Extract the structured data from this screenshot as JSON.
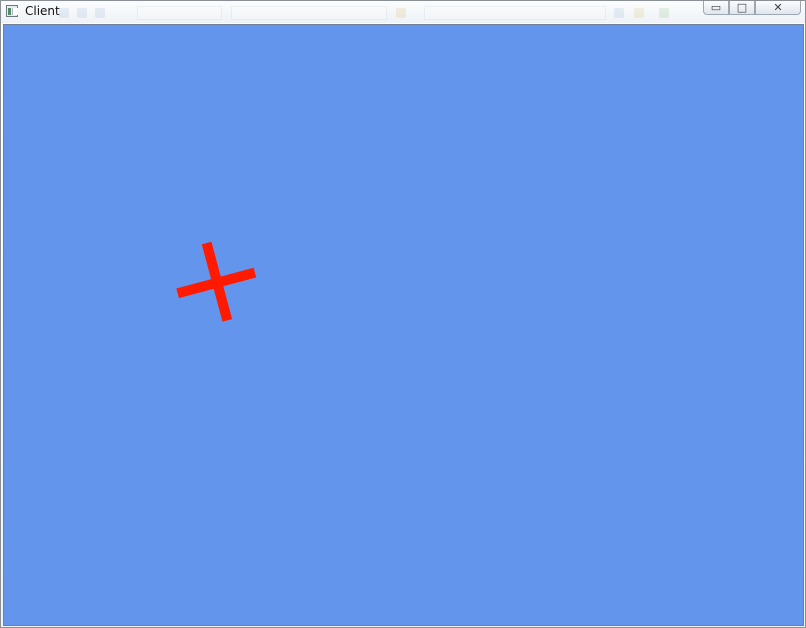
{
  "window": {
    "title": "Client",
    "controls": {
      "minimize_icon": "minimize-icon",
      "maximize_icon": "maximize-icon",
      "close_icon": "close-icon"
    }
  },
  "canvas": {
    "background_color": "#6495ED",
    "marker": {
      "shape": "cross",
      "color": "#FF1A00",
      "rotation_deg": -15
    }
  }
}
